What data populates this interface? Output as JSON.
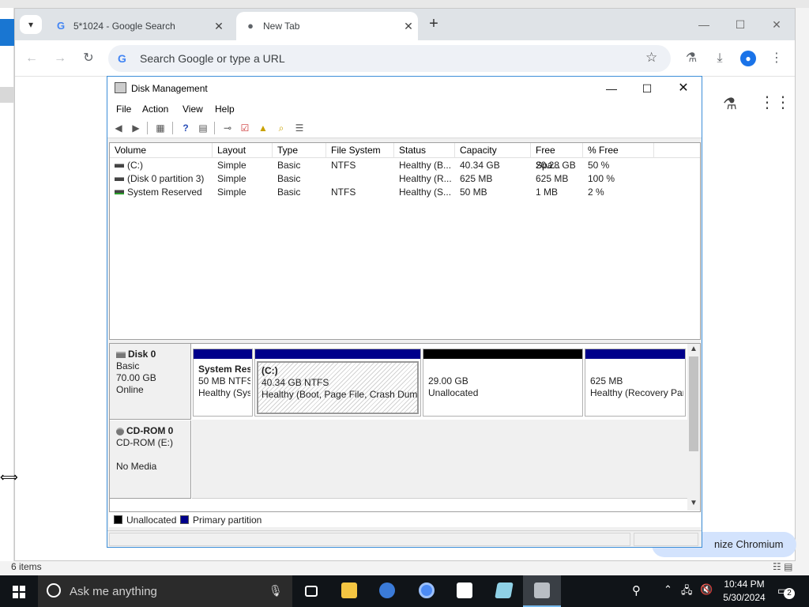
{
  "explorer": {
    "status_items": "6 items"
  },
  "chrome": {
    "tabs": [
      {
        "title": "5*1024 - Google Search",
        "favicon": "G"
      },
      {
        "title": "New Tab",
        "favicon": "●"
      }
    ],
    "omnibox": {
      "placeholder": "Search Google or type a URL",
      "value": ""
    },
    "ntp": {
      "customize_label": "nize Chromium"
    }
  },
  "disk_management": {
    "title": "Disk Management",
    "menu": [
      "File",
      "Action",
      "View",
      "Help"
    ],
    "columns": [
      "Volume",
      "Layout",
      "Type",
      "File System",
      "Status",
      "Capacity",
      "Free Spa...",
      "% Free"
    ],
    "volumes": [
      {
        "volume": "(C:)",
        "layout": "Simple",
        "type": "Basic",
        "fs": "NTFS",
        "status": "Healthy (B...",
        "capacity": "40.34 GB",
        "free": "20.28 GB",
        "pct": "50 %"
      },
      {
        "volume": "(Disk 0 partition 3)",
        "layout": "Simple",
        "type": "Basic",
        "fs": "",
        "status": "Healthy (R...",
        "capacity": "625 MB",
        "free": "625 MB",
        "pct": "100 %"
      },
      {
        "volume": "System Reserved",
        "layout": "Simple",
        "type": "Basic",
        "fs": "NTFS",
        "status": "Healthy (S...",
        "capacity": "50 MB",
        "free": "1 MB",
        "pct": "2 %"
      }
    ],
    "disk0": {
      "name": "Disk 0",
      "type": "Basic",
      "size": "70.00 GB",
      "state": "Online",
      "partitions": [
        {
          "name": "System Res",
          "line2": "50 MB NTFS",
          "line3": "Healthy (Sys",
          "bar_color": "#00008b"
        },
        {
          "name": "(C:)",
          "line2": "40.34 GB NTFS",
          "line3": "Healthy (Boot, Page File, Crash Dump",
          "bar_color": "#00008b"
        },
        {
          "name": "",
          "line2": "29.00 GB",
          "line3": "Unallocated",
          "bar_color": "#000000"
        },
        {
          "name": "",
          "line2": "625 MB",
          "line3": "Healthy (Recovery Par",
          "bar_color": "#00008b"
        }
      ]
    },
    "cdrom0": {
      "name": "CD-ROM 0",
      "drive": "CD-ROM (E:)",
      "media": "No Media"
    },
    "legend": [
      {
        "label": "Unallocated",
        "color": "#000000"
      },
      {
        "label": "Primary partition",
        "color": "#00008b"
      }
    ]
  },
  "taskbar": {
    "search_placeholder": "Ask me anything",
    "time": "10:44 PM",
    "date": "5/30/2024",
    "notification_count": "2"
  }
}
